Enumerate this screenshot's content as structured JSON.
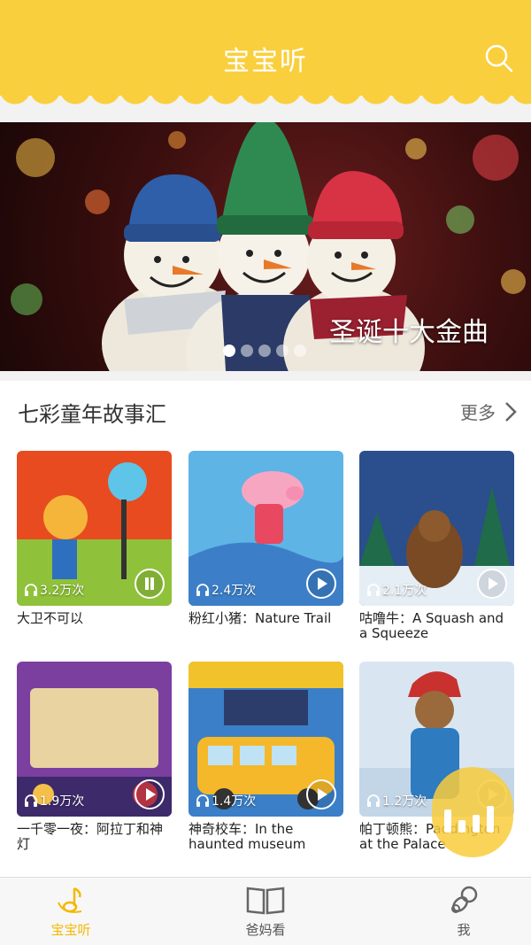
{
  "header": {
    "title": "宝宝听"
  },
  "banner": {
    "caption": "圣诞十大金曲",
    "dot_count": 5,
    "active_dot": 0
  },
  "section": {
    "title": "七彩童年故事汇",
    "more_label": "更多",
    "items": [
      {
        "title": "大卫不可以",
        "plays": "3.2万次",
        "cover_bg": "#e84b1f"
      },
      {
        "title": "粉红小猪：Nature Trail",
        "plays": "2.4万次",
        "cover_bg": "#5fb4e6"
      },
      {
        "title": "咕噜牛：A Squash and a Squeeze",
        "plays": "2.1万次",
        "cover_bg": "#2a4f8c"
      },
      {
        "title": "一千零一夜：阿拉丁和神灯",
        "plays": "1.9万次",
        "cover_bg": "#7b3fa0"
      },
      {
        "title": "神奇校车：In the haunted museum",
        "plays": "1.4万次",
        "cover_bg": "#3a7fc8"
      },
      {
        "title": "帕丁顿熊：Paddington at the Palace",
        "plays": "1.2万次",
        "cover_bg": "#d9e6f2"
      }
    ]
  },
  "tabs": [
    {
      "label": "宝宝听",
      "icon": "music-note-icon",
      "active": true
    },
    {
      "label": "爸妈看",
      "icon": "book-icon",
      "active": false
    },
    {
      "label": "我",
      "icon": "pacifier-icon",
      "active": false
    }
  ],
  "colors": {
    "accent": "#f9cf3d",
    "active_tab": "#f5b800"
  }
}
